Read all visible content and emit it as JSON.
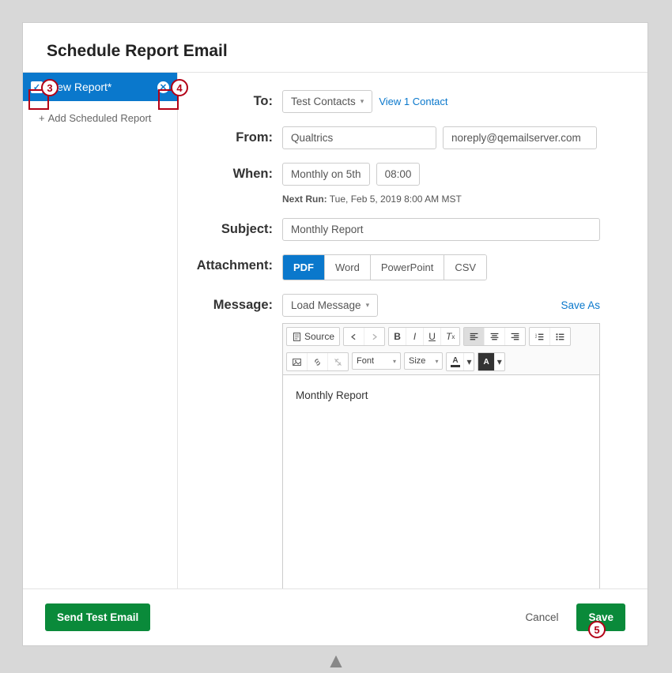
{
  "title": "Schedule Report Email",
  "sidebar": {
    "report_label": "New Report*",
    "add_label": "Add Scheduled Report"
  },
  "form": {
    "to_label": "To:",
    "to_value": "Test Contacts",
    "to_link": "View 1 Contact",
    "from_label": "From:",
    "from_name": "Qualtrics",
    "from_email": "noreply@qemailserver.com",
    "when_label": "When:",
    "when_freq": "Monthly on 5th",
    "when_time": "08:00",
    "next_run_label": "Next Run:",
    "next_run_value": "Tue, Feb 5, 2019 8:00 AM MST",
    "subject_label": "Subject:",
    "subject_value": "Monthly Report",
    "attachment_label": "Attachment:",
    "attachment_options": {
      "pdf": "PDF",
      "word": "Word",
      "powerpoint": "PowerPoint",
      "csv": "CSV"
    },
    "message_label": "Message:",
    "load_message": "Load Message",
    "save_as": "Save As",
    "message_body": "Monthly Report"
  },
  "toolbar": {
    "source": "Source",
    "font": "Font",
    "size": "Size",
    "A": "A"
  },
  "footer": {
    "send_test": "Send Test Email",
    "cancel": "Cancel",
    "save": "Save"
  },
  "callouts": {
    "c3": "3",
    "c4": "4",
    "c5": "5"
  }
}
